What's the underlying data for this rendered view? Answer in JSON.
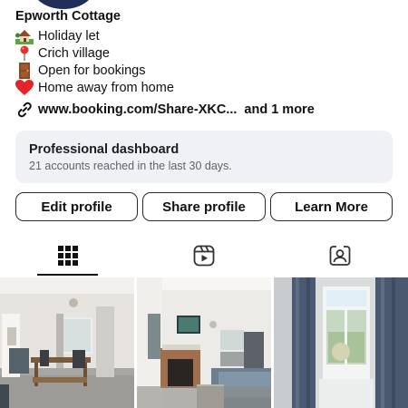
{
  "profile": {
    "name": "Epworth Cottage",
    "bio": [
      {
        "icon": "house-with-garden-icon",
        "text": "Holiday let"
      },
      {
        "icon": "round-pushpin-icon",
        "text": "Crich village"
      },
      {
        "icon": "door-icon",
        "text": "Open for bookings"
      },
      {
        "icon": "red-heart-icon",
        "text": "Home away from home"
      }
    ],
    "link": {
      "icon": "link-icon",
      "url": "www.booking.com/Share-XKC...",
      "more": "and 1 more"
    }
  },
  "dashboard": {
    "title": "Professional dashboard",
    "subtitle": "21 accounts reached in the last 30 days."
  },
  "buttons": {
    "edit": "Edit profile",
    "share": "Share profile",
    "learn": "Learn More"
  },
  "tabs": [
    {
      "icon": "grid-icon",
      "active": true
    },
    {
      "icon": "reels-icon",
      "active": false
    },
    {
      "icon": "tagged-person-icon",
      "active": false
    }
  ],
  "colors": {
    "dashboard_bg": "#eff1f4",
    "text": "#111111",
    "subtext": "#5f6368"
  }
}
